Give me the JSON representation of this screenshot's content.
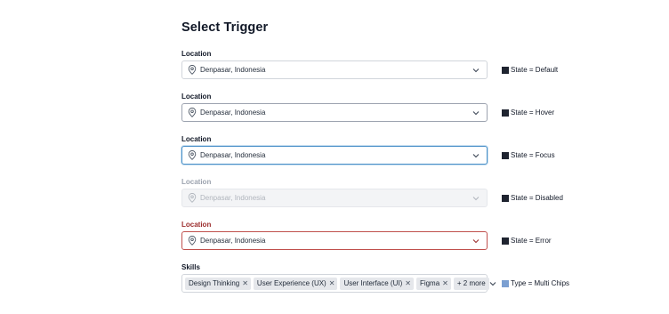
{
  "page": {
    "title": "Select Trigger"
  },
  "rows": [
    {
      "label": "Location",
      "value": "Denpasar, Indonesia",
      "state": "State = Default"
    },
    {
      "label": "Location",
      "value": "Denpasar, Indonesia",
      "state": "State = Hover"
    },
    {
      "label": "Location",
      "value": "Denpasar, Indonesia",
      "state": "State = Focus"
    },
    {
      "label": "Location",
      "value": "Denpasar, Indonesia",
      "state": "State = Disabled"
    },
    {
      "label": "Location",
      "value": "Denpasar, Indonesia",
      "state": "State = Error"
    }
  ],
  "skills": {
    "label": "Skills",
    "chips": [
      "Design Thinking",
      "User Experience (UX)",
      "User Interface (UI)",
      "Figma"
    ],
    "more": "+ 2 more",
    "state": "Type = Multi Chips"
  },
  "colors": {
    "swatch_dark": "#1f2430",
    "swatch_blue": "#7b9fd1",
    "focus_border": "#4a90c8",
    "error_border": "#c0504d",
    "error_label": "#9b2c2c"
  },
  "icons": {
    "location": "map-pin-icon",
    "chevron": "chevron-down-icon",
    "remove": "close-icon"
  }
}
